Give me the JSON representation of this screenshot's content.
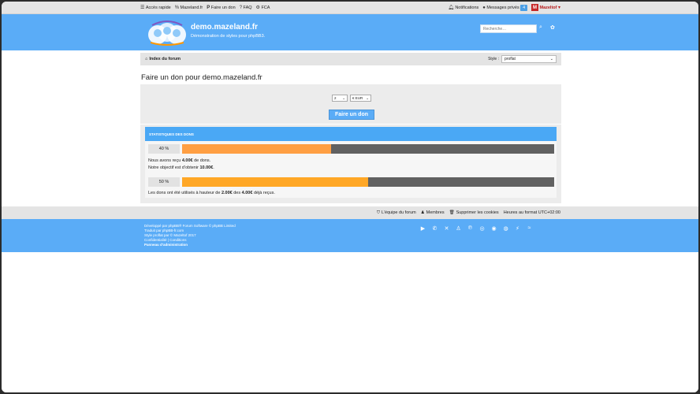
{
  "topbar": {
    "quick_access": "Accès rapide",
    "site_link": "Mazeland.fr",
    "donate_link": "Faire un don",
    "faq": "FAQ",
    "fca": "FCA",
    "notifications": "Notifications",
    "messages": "Messages privés",
    "messages_count": "4",
    "user_initial": "M",
    "username": "Mazeltof"
  },
  "header": {
    "title": "demo.mazeland.fr",
    "description": "Démonstration de styles pour phpBB3.",
    "search_placeholder": "Recherche…"
  },
  "navbar": {
    "breadcrumb": "Index du forum",
    "style_label": "Style :",
    "style_value": "proflat"
  },
  "page": {
    "title": "Faire un don pour demo.mazeland.fr"
  },
  "donate": {
    "amount": "2",
    "currency": "€ EUR",
    "button": "Faire un don"
  },
  "stats": {
    "heading": "STATISTIQUES DES DONS",
    "goal_pct_label": "40 %",
    "goal_pct": 0.4,
    "received_prefix": "Nous avons reçu ",
    "received_amount": "4.00€",
    "received_suffix": " de dons.",
    "goal_prefix": "Notre objectif est d’obtenir ",
    "goal_amount": "10.00€",
    "goal_suffix": ".",
    "used_pct_label": "50 %",
    "used_pct": 0.5,
    "used_prefix": "Les dons ont été utilisés à hauteur de ",
    "used_amount": "2.00€",
    "used_mid": " des ",
    "used_total": "4.00€",
    "used_suffix": " déjà reçus."
  },
  "footer_nav": {
    "team": "L’équipe du forum",
    "members": "Membres",
    "delete_cookies": "Supprimer les cookies",
    "timezone": "Heures au format UTC+02:00"
  },
  "footer": {
    "line1": "Développé par phpBB® Forum Software © phpBB Limited",
    "line2": "Traduit par phpBB-fr.com",
    "line3": "Style proflat par © Mazeltof 2017",
    "privacy": "Confidentialité",
    "sep": " | ",
    "terms": "Conditions",
    "admin": "Panneau d’administration"
  },
  "colors": {
    "brand_blue": "#5aacf7",
    "bar_goal": "#ff9f43",
    "bar_used": "#ffa726",
    "bar_bg": "#616161"
  },
  "social_icons": [
    "youtube-icon",
    "whatsapp-icon",
    "x-icon",
    "snapchat-icon",
    "pinterest-icon",
    "instagram-icon",
    "github-icon",
    "discord-icon",
    "deviantart-icon",
    "rss-icon"
  ]
}
